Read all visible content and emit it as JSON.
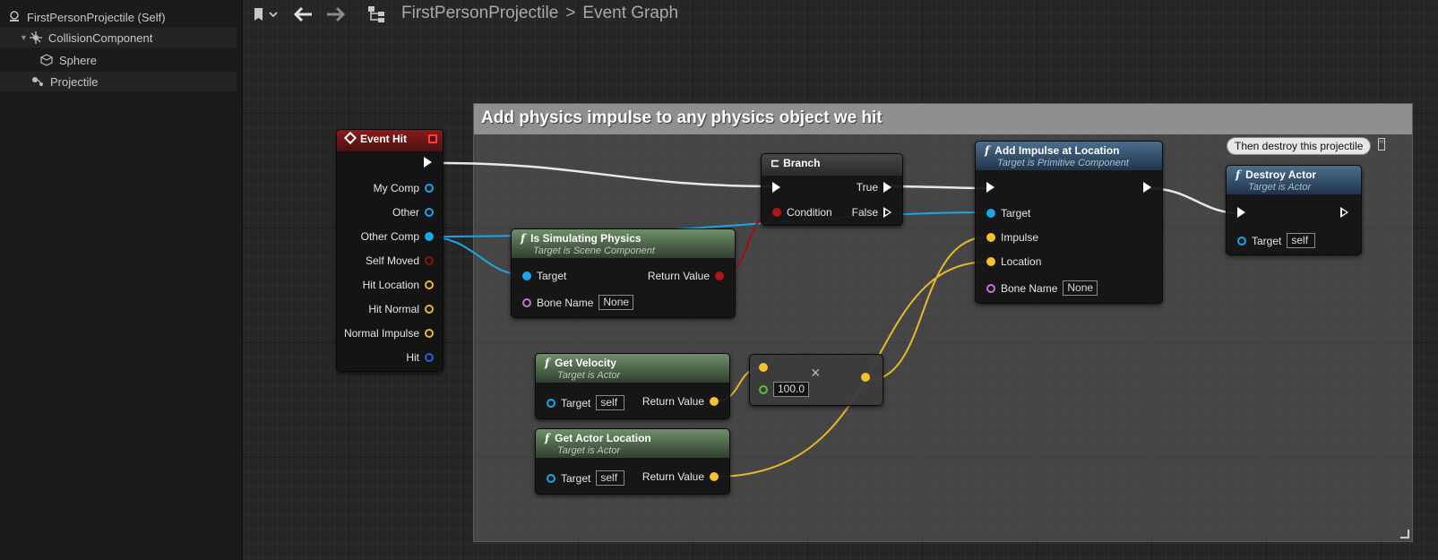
{
  "tree": {
    "root": "FirstPersonProjectile (Self)",
    "collision": "CollisionComponent",
    "sphere": "Sphere",
    "projectile": "Projectile"
  },
  "breadcrumb": {
    "blueprint": "FirstPersonProjectile",
    "separator": ">",
    "graph": "Event Graph"
  },
  "comment": {
    "title": "Add physics impulse to any physics object we hit"
  },
  "nodes": {
    "event_hit": {
      "title": "Event Hit",
      "pins": [
        "My Comp",
        "Other",
        "Other Comp",
        "Self Moved",
        "Hit Location",
        "Hit Normal",
        "Normal Impulse",
        "Hit"
      ]
    },
    "is_simulating": {
      "title": "Is Simulating Physics",
      "subtitle": "Target is Scene Component",
      "target": "Target",
      "bone_name": "Bone Name",
      "bone_value": "None",
      "return": "Return Value"
    },
    "branch": {
      "title": "Branch",
      "true": "True",
      "false": "False",
      "condition": "Condition"
    },
    "add_impulse": {
      "title": "Add Impulse at Location",
      "subtitle": "Target is Primitive Component",
      "target": "Target",
      "impulse": "Impulse",
      "location": "Location",
      "bone_name": "Bone Name",
      "bone_value": "None"
    },
    "destroy": {
      "title": "Destroy Actor",
      "subtitle": "Target is Actor",
      "target": "Target",
      "target_value": "self",
      "note": "Then destroy this projectile"
    },
    "get_velocity": {
      "title": "Get Velocity",
      "subtitle": "Target is Actor",
      "target": "Target",
      "target_value": "self",
      "return": "Return Value"
    },
    "get_location": {
      "title": "Get Actor Location",
      "subtitle": "Target is Actor",
      "target": "Target",
      "target_value": "self",
      "return": "Return Value"
    },
    "multiply": {
      "symbol": "×",
      "value": "100.0"
    }
  },
  "colors": {
    "object": "#1aa6e8",
    "bool": "#b01414",
    "vector": "#f4c22b",
    "exec": "#ffffff"
  }
}
